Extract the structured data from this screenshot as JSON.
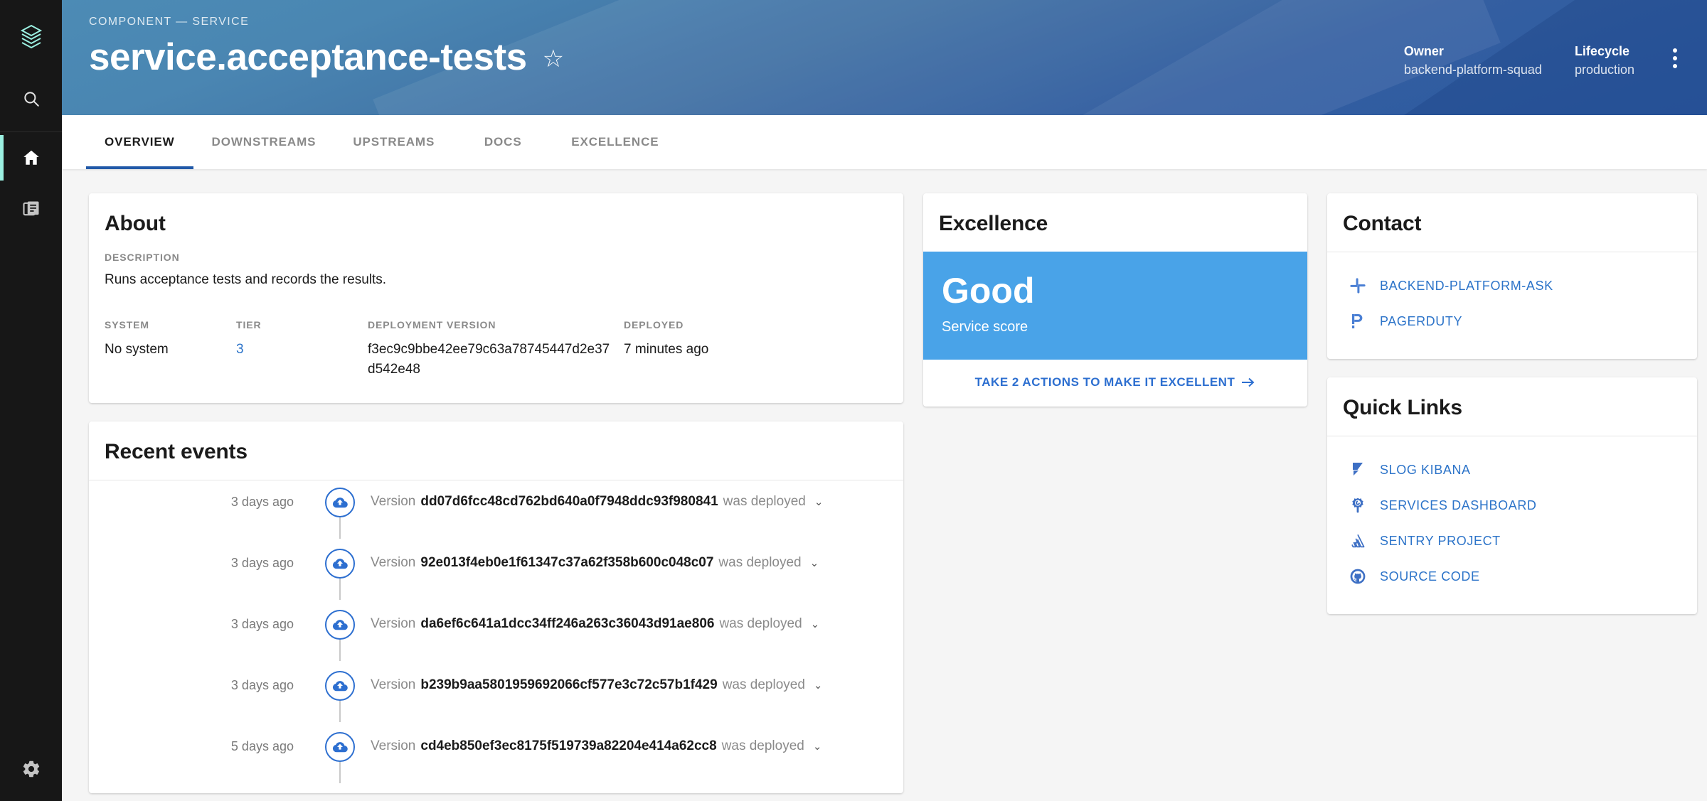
{
  "sidebar": {
    "logo_icon": "backstage-logo-icon",
    "search_icon": "search-icon",
    "items": [
      {
        "name": "home",
        "icon": "home-icon",
        "active": true
      },
      {
        "name": "docs",
        "icon": "docs-icon",
        "active": false
      }
    ],
    "bottom": {
      "name": "settings",
      "icon": "gear-icon"
    }
  },
  "header": {
    "breadcrumb": "COMPONENT — SERVICE",
    "title": "service.acceptance-tests",
    "star_icon": "star-outline-icon",
    "fields": [
      {
        "label": "Owner",
        "value": "backend-platform-squad"
      },
      {
        "label": "Lifecycle",
        "value": "production"
      }
    ],
    "more_icon": "kebab-menu-icon"
  },
  "tabs": [
    {
      "label": "OVERVIEW",
      "active": true
    },
    {
      "label": "DOWNSTREAMS",
      "active": false
    },
    {
      "label": "UPSTREAMS",
      "active": false
    },
    {
      "label": "DOCS",
      "active": false
    },
    {
      "label": "EXCELLENCE",
      "active": false
    }
  ],
  "about": {
    "title": "About",
    "description_label": "DESCRIPTION",
    "description": "Runs acceptance tests and records the results.",
    "fields": {
      "system_label": "SYSTEM",
      "system_value": "No system",
      "tier_label": "TIER",
      "tier_value": "3",
      "deployment_version_label": "DEPLOYMENT VERSION",
      "deployment_version_value": "f3ec9c9bbe42ee79c63a78745447d2e37d542e48",
      "deployed_label": "DEPLOYED",
      "deployed_value": "7 minutes ago"
    }
  },
  "recent_events": {
    "title": "Recent events",
    "events": [
      {
        "time": "3 days ago",
        "prefix": "Version",
        "version": "dd07d6fcc48cd762bd640a0f7948ddc93f980841",
        "suffix": "was deployed",
        "icon": "deploy-upload-icon",
        "caret": "chevron-down-icon"
      },
      {
        "time": "3 days ago",
        "prefix": "Version",
        "version": "92e013f4eb0e1f61347c37a62f358b600c048c07",
        "suffix": "was deployed",
        "icon": "deploy-upload-icon",
        "caret": "chevron-down-icon"
      },
      {
        "time": "3 days ago",
        "prefix": "Version",
        "version": "da6ef6c641a1dcc34ff246a263c36043d91ae806",
        "suffix": "was deployed",
        "icon": "deploy-upload-icon",
        "caret": "chevron-down-icon"
      },
      {
        "time": "3 days ago",
        "prefix": "Version",
        "version": "b239b9aa5801959692066cf577e3c72c57b1f429",
        "suffix": "was deployed",
        "icon": "deploy-upload-icon",
        "caret": "chevron-down-icon"
      },
      {
        "time": "5 days ago",
        "prefix": "Version",
        "version": "cd4eb850ef3ec8175f519739a82204e414a62cc8",
        "suffix": "was deployed",
        "icon": "deploy-upload-icon",
        "caret": "chevron-down-icon"
      }
    ]
  },
  "excellence": {
    "title": "Excellence",
    "score": "Good",
    "score_caption": "Service score",
    "action_label": "TAKE 2 ACTIONS TO MAKE IT EXCELLENT",
    "action_icon": "arrow-right-icon",
    "banner_color": "#49a3e8"
  },
  "contact": {
    "title": "Contact",
    "links": [
      {
        "label": "BACKEND-PLATFORM-ASK",
        "icon": "slack-icon"
      },
      {
        "label": "PAGERDUTY",
        "icon": "pagerduty-icon"
      }
    ]
  },
  "quick_links": {
    "title": "Quick Links",
    "links": [
      {
        "label": "SLOG KIBANA",
        "icon": "kibana-icon"
      },
      {
        "label": "SERVICES DASHBOARD",
        "icon": "grafana-icon"
      },
      {
        "label": "SENTRY PROJECT",
        "icon": "sentry-icon"
      },
      {
        "label": "SOURCE CODE",
        "icon": "github-icon"
      }
    ]
  },
  "colors": {
    "accent_blue": "#2d74c9",
    "header_gradient_start": "#4c8bb5",
    "header_gradient_end": "#1f4f9b",
    "sidebar_bg": "#171717",
    "sidebar_active_indicator": "#9BF0E1",
    "excellence_banner": "#49a3e8"
  }
}
